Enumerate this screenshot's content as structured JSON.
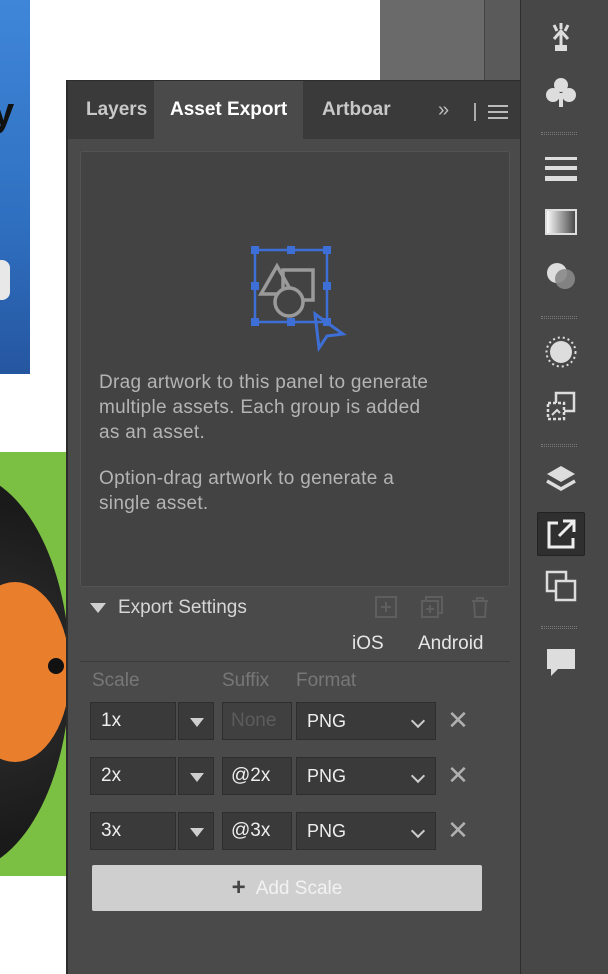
{
  "panel": {
    "tabs": [
      {
        "label": "Layers",
        "active": false
      },
      {
        "label": "Asset Export",
        "active": true
      },
      {
        "label": "Artboar",
        "active": false
      }
    ],
    "overflow_label": "»"
  },
  "dropzone": {
    "text1": "Drag artwork to this panel to generate\nmultiple assets. Each group is added\nas an asset.",
    "text2": "Option-drag artwork to generate a\nsingle asset."
  },
  "export_settings": {
    "title": "Export Settings",
    "platforms": [
      "iOS",
      "Android"
    ],
    "columns": {
      "scale": "Scale",
      "suffix": "Suffix",
      "format": "Format"
    },
    "rows": [
      {
        "scale": "1x",
        "suffix": "",
        "suffix_placeholder": "None",
        "format": "PNG"
      },
      {
        "scale": "2x",
        "suffix": "@2x",
        "suffix_placeholder": "",
        "format": "PNG"
      },
      {
        "scale": "3x",
        "suffix": "@3x",
        "suffix_placeholder": "",
        "format": "PNG"
      }
    ],
    "add_scale_label": "Add Scale"
  },
  "toolbar": {
    "icons": [
      "puppet-warp-icon",
      "symbols-club-icon",
      "stroke-lines-icon",
      "gradient-icon",
      "transparency-icon",
      "appearance-icon",
      "image-trace-icon",
      "layers-icon",
      "asset-export-icon",
      "artboards-icon",
      "comments-icon"
    ]
  },
  "colors": {
    "panel_bg": "#4a4a4a",
    "accent_blue": "#3d6fd6"
  }
}
